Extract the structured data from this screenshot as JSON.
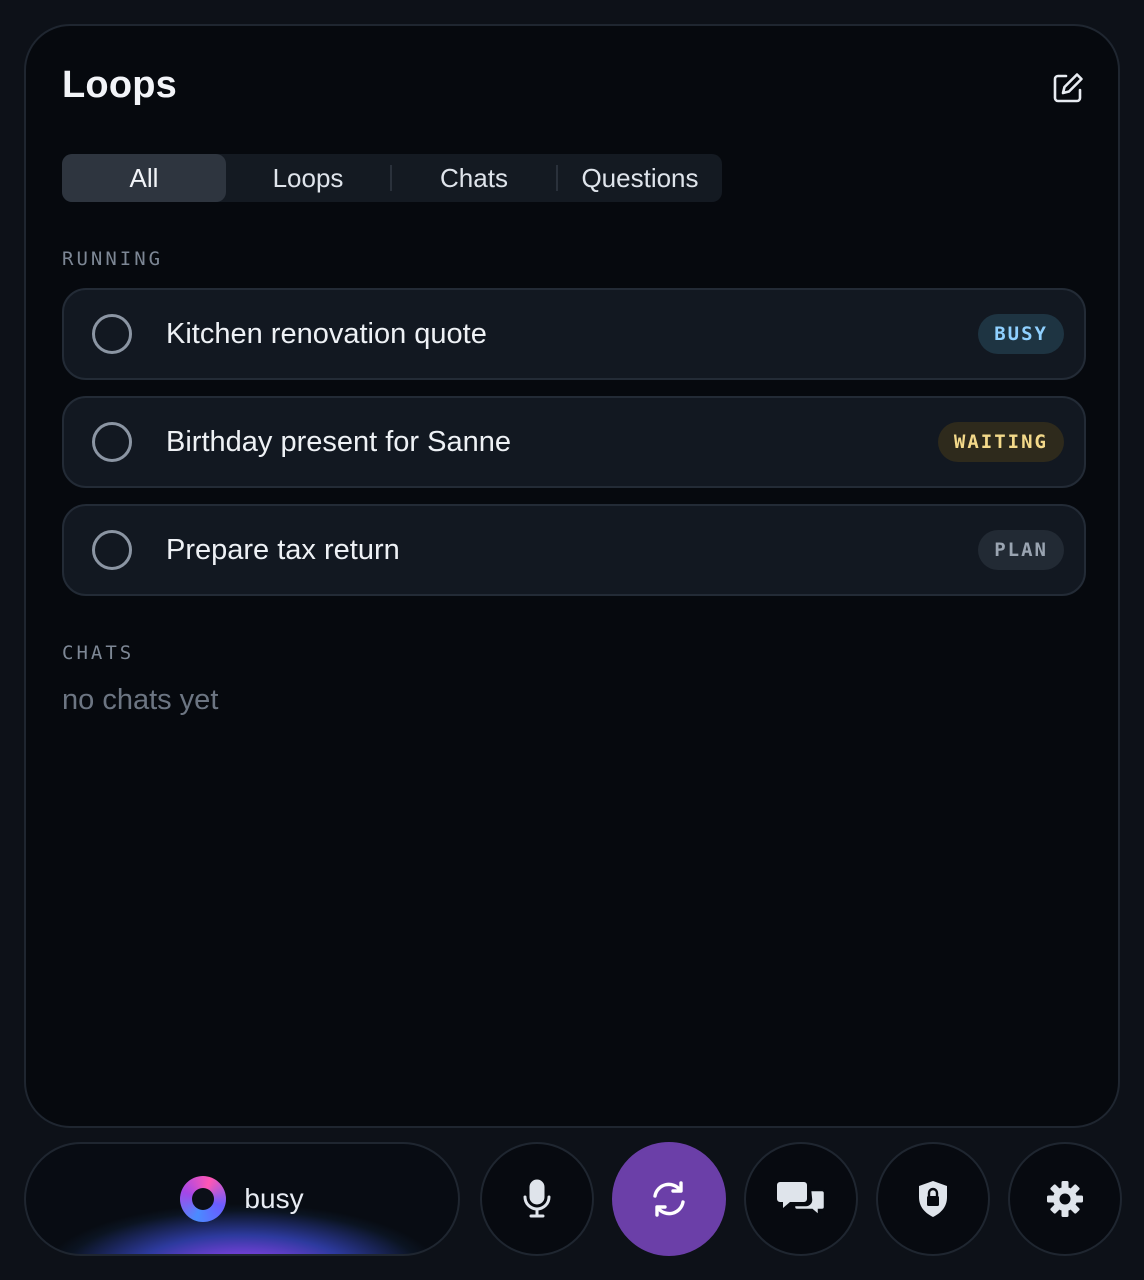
{
  "header": {
    "title": "Loops"
  },
  "tabs": [
    {
      "label": "All",
      "active": true
    },
    {
      "label": "Loops",
      "active": false
    },
    {
      "label": "Chats",
      "active": false
    },
    {
      "label": "Questions",
      "active": false
    }
  ],
  "sections": {
    "running": {
      "label": "RUNNING",
      "items": [
        {
          "label": "Kitchen renovation quote",
          "status": "BUSY",
          "status_color": "#8fd0ff",
          "status_bg": "#1e3442"
        },
        {
          "label": "Birthday present for Sanne",
          "status": "WAITING",
          "status_color": "#f3d98a",
          "status_bg": "#2e2a1c"
        },
        {
          "label": "Prepare tax return",
          "status": "PLAN",
          "status_color": "#9aa4b1",
          "status_bg": "#222a34"
        }
      ]
    },
    "chats": {
      "label": "CHATS",
      "empty_text": "no chats yet"
    }
  },
  "bottom_bar": {
    "status_text": "busy",
    "buttons": [
      {
        "name": "microphone-button",
        "icon": "microphone-icon"
      },
      {
        "name": "sync-button",
        "icon": "refresh-icon"
      },
      {
        "name": "chats-button",
        "icon": "chat-bubbles-icon"
      },
      {
        "name": "lock-button",
        "icon": "shield-lock-icon"
      },
      {
        "name": "settings-button",
        "icon": "gear-icon"
      }
    ]
  },
  "colors": {
    "accent": "#6b3fa8",
    "background": "#06090e"
  }
}
